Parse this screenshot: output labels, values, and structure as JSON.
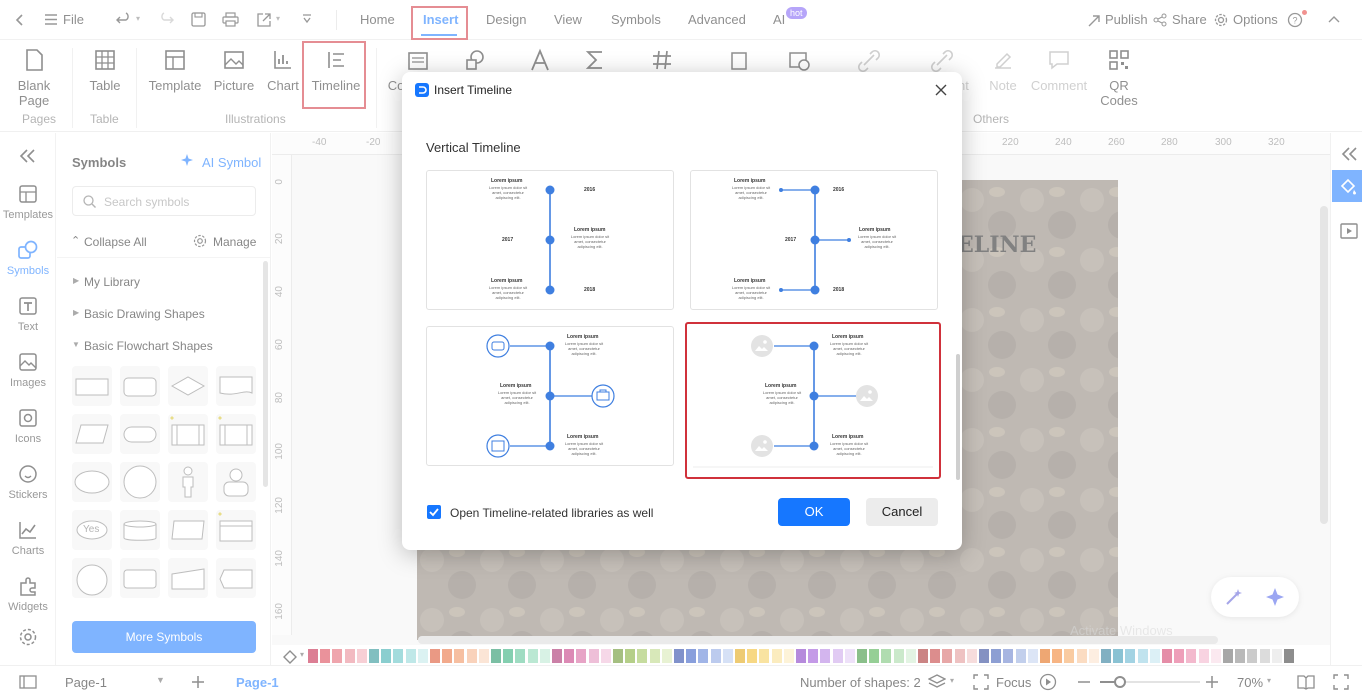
{
  "menubar": {
    "file": "File",
    "tabs": [
      "Home",
      "Insert",
      "Design",
      "View",
      "Symbols",
      "Advanced",
      "AI"
    ],
    "ai_badge": "hot",
    "publish": "Publish",
    "share": "Share",
    "options": "Options"
  },
  "ribbon": {
    "blank_page": "Blank Page",
    "table": "Table",
    "template": "Template",
    "picture": "Picture",
    "chart": "Chart",
    "timeline": "Timeline",
    "co_partial": "Co",
    "nt_partial": "nt",
    "note": "Note",
    "comment": "Comment",
    "qr": "QR Codes",
    "groups": {
      "pages": "Pages",
      "table": "Table",
      "illustrations": "Illustrations",
      "others": "Others"
    }
  },
  "rail": [
    {
      "label": "Templates",
      "icon": "templates-icon"
    },
    {
      "label": "Symbols",
      "icon": "symbols-icon"
    },
    {
      "label": "Text",
      "icon": "text-icon"
    },
    {
      "label": "Images",
      "icon": "images-icon"
    },
    {
      "label": "Icons",
      "icon": "icons-icon"
    },
    {
      "label": "Stickers",
      "icon": "stickers-icon"
    },
    {
      "label": "Charts",
      "icon": "charts-icon"
    },
    {
      "label": "Widgets",
      "icon": "widgets-icon"
    }
  ],
  "symbols": {
    "title": "Symbols",
    "ai_symbol": "AI Symbol",
    "search_placeholder": "Search symbols",
    "collapse_all": "Collapse All",
    "manage": "Manage",
    "my_library": "My Library",
    "basic_drawing": "Basic Drawing Shapes",
    "basic_flowchart": "Basic Flowchart Shapes",
    "yes": "Yes",
    "more": "More Symbols"
  },
  "ruler_h": [
    "-40",
    "-20",
    "220",
    "240",
    "260",
    "280",
    "300",
    "320"
  ],
  "ruler_v": [
    "0",
    "20",
    "40",
    "60",
    "80",
    "100",
    "120",
    "140",
    "160"
  ],
  "canvas": {
    "title_partial": "ELINE"
  },
  "dialog": {
    "title": "Insert Timeline",
    "section": "Vertical Timeline",
    "lorem": "Lorem ipsum",
    "lorem_body": "Lorem ipsum dolor sit amet, consectetur adipiscing elit.",
    "years": [
      "2016",
      "2017",
      "2018"
    ],
    "checkbox_label": "Open Timeline-related libraries as well",
    "checkbox_checked": true,
    "ok": "OK",
    "cancel": "Cancel"
  },
  "status": {
    "page_select": "Page-1",
    "page_tab": "Page-1",
    "shapes": "Number of shapes: 2",
    "focus": "Focus",
    "zoom": "70%",
    "zoom_level": 0.2,
    "watermark": "Activate Windows"
  },
  "colors": {
    "accent": "#1677ff",
    "highlight": "#d0313b",
    "timeline": "#3f7fe0"
  }
}
